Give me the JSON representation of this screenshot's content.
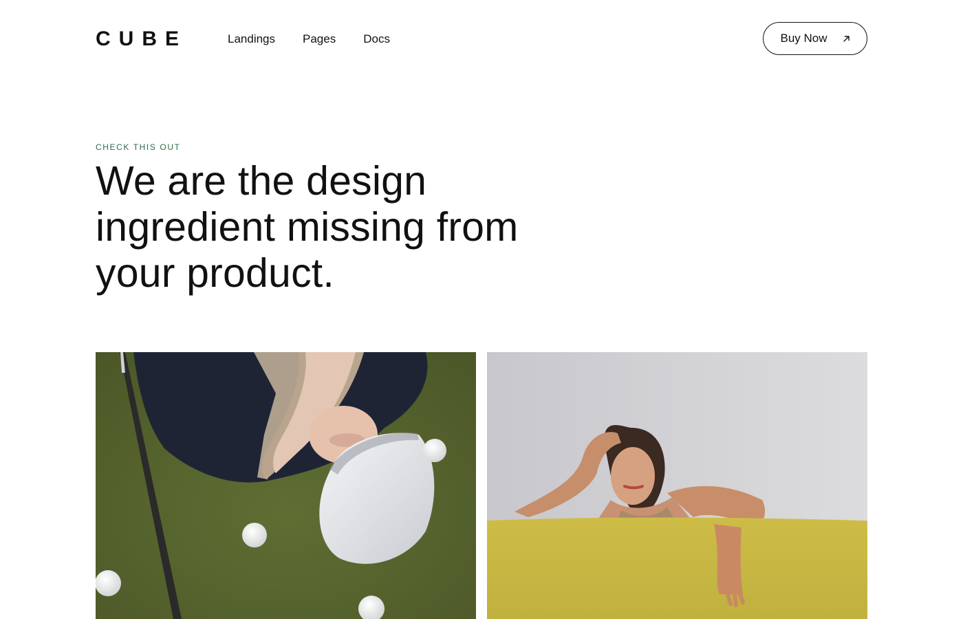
{
  "header": {
    "logo": "CUBE",
    "nav": [
      "Landings",
      "Pages",
      "Docs"
    ],
    "cta_label": "Buy Now",
    "cta_icon": "arrow-up-right-icon"
  },
  "hero": {
    "eyebrow": "CHECK THIS OUT",
    "headline_lines": [
      "We are the design",
      "ingredient missing from",
      "your product."
    ]
  },
  "gallery": {
    "images": [
      "photo-person-lying-on-golf-green",
      "photo-woman-leaning-on-yellow-sofa"
    ]
  },
  "colors": {
    "accent_green": "#2f6b4a",
    "text": "#111111",
    "grass": "#55642e",
    "sofa_yellow": "#c9bb45",
    "wall_grey": "#d0cfd2"
  }
}
